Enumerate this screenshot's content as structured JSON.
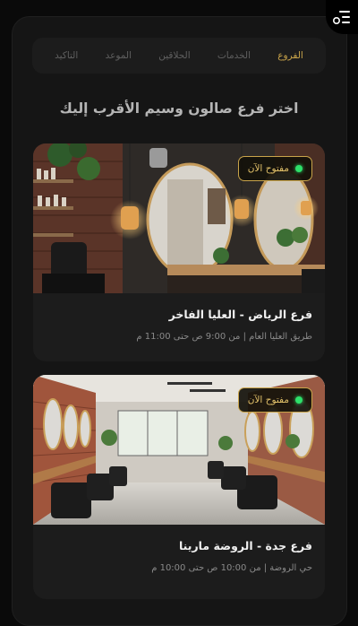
{
  "steps": [
    {
      "label": "الفروع",
      "active": true
    },
    {
      "label": "الخدمات",
      "active": false
    },
    {
      "label": "الحلاقين",
      "active": false
    },
    {
      "label": "الموعد",
      "active": false
    },
    {
      "label": "التاكيد",
      "active": false
    }
  ],
  "headline": "اختر فرع صالون وسيم الأقرب إليك",
  "branches": [
    {
      "status": "مفتوح الآن",
      "name": "فرع الرياض - العليا الفاخر",
      "details": "طريق العليا العام | من 9:00 ص حتى 11:00 م"
    },
    {
      "status": "مفتوح الآن",
      "name": "فرع جدة - الروضة مارينا",
      "details": "حي الروضة | من 10:00 ص حتى 10:00 م"
    }
  ],
  "colors": {
    "accent": "#c9a44a",
    "open_dot": "#2ee06a",
    "background": "#0a0a0a",
    "card": "#1c1c1c"
  },
  "icons": {
    "menu": "menu-icon"
  }
}
